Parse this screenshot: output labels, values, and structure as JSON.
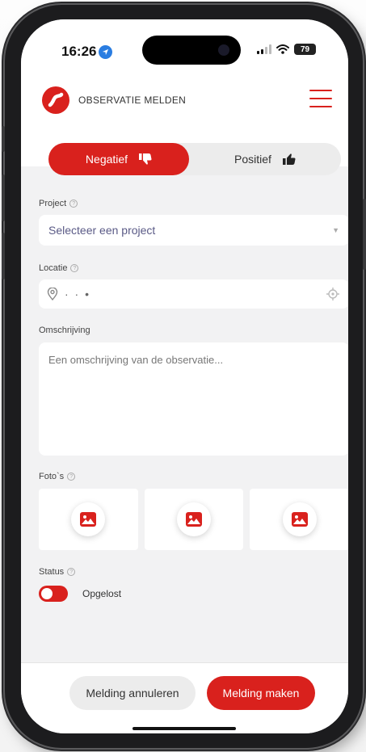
{
  "status_bar": {
    "time": "16:26",
    "battery": "79"
  },
  "header": {
    "brand": "OBSERVATIE MELDEN"
  },
  "segment": {
    "negative_label": "Negatief",
    "positive_label": "Positief"
  },
  "form": {
    "project": {
      "label": "Project",
      "placeholder": "Selecteer een project"
    },
    "location": {
      "label": "Locatie",
      "value": "· · •"
    },
    "description": {
      "label": "Omschrijving",
      "placeholder": "Een omschrijving van de observatie..."
    },
    "photos": {
      "label": "Foto`s",
      "slots": 3
    },
    "status": {
      "label": "Status",
      "toggle_label": "Opgelost"
    }
  },
  "footer": {
    "cancel_label": "Melding annuleren",
    "submit_label": "Melding maken"
  },
  "colors": {
    "accent": "#d9211d",
    "field_bg": "#ffffff",
    "screen_bg": "#f2f2f3"
  },
  "icons": [
    "location-arrow-icon",
    "signal-icon",
    "wifi-icon",
    "battery-icon",
    "logo-icon",
    "hamburger-menu-icon",
    "thumbs-down-icon",
    "thumbs-up-icon",
    "help-icon",
    "chevron-down-icon",
    "map-pin-icon",
    "crosshair-icon",
    "image-icon"
  ]
}
